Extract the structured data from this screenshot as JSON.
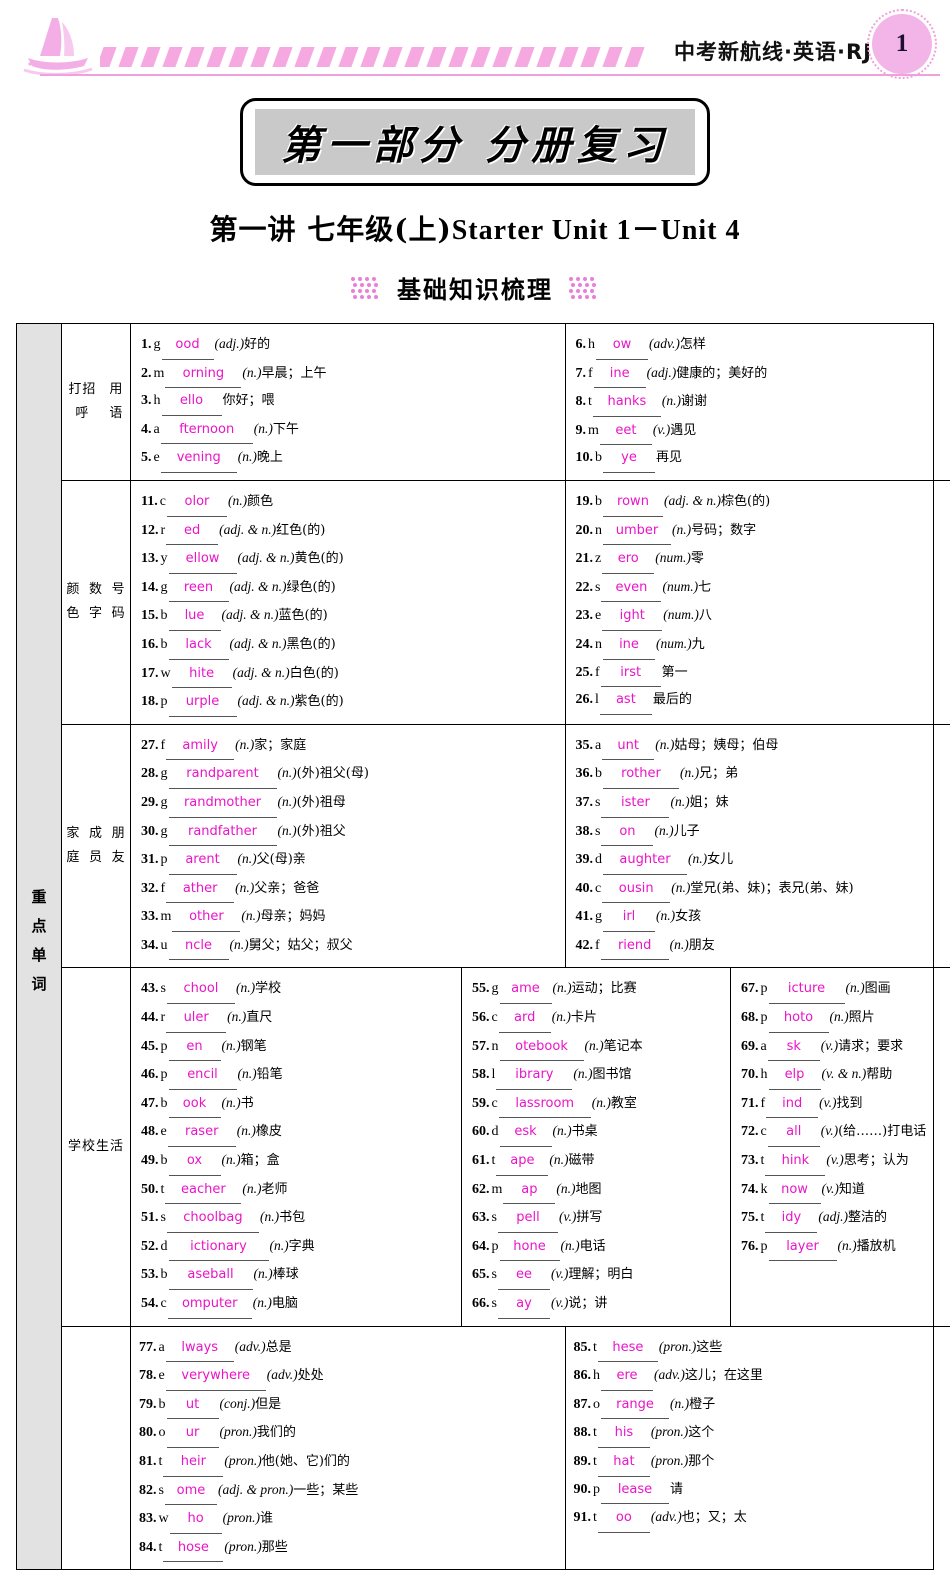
{
  "header": {
    "title": "中考新航线·英语·RJ",
    "page_number": "1",
    "logo": "sailboat-logo"
  },
  "part": {
    "title": "第一部分  分册复习"
  },
  "lecture": {
    "cn": "第一讲   七年级(上)",
    "en": "Starter Unit 1－Unit 4"
  },
  "section": {
    "heading": "基础知识梳理"
  },
  "sidebar": {
    "label": "重点单词"
  },
  "colors": {
    "answer": "#ea14c8",
    "accent": "#f0a0da",
    "sidebar_bg": "#e2e2e2"
  },
  "bands": [
    {
      "category": "打招呼\n用语",
      "columns": [
        {
          "entries": [
            {
              "num": "1.",
              "pre": "g",
              "ans": "ood",
              "pos": "(adj.)",
              "cn": "好的"
            },
            {
              "num": "2.",
              "pre": "m",
              "ans": "orning",
              "pos": "(n.)",
              "cn": "早晨；上午"
            },
            {
              "num": "3.",
              "pre": "h",
              "ans": "ello",
              "pos": "",
              "cn": "你好；喂"
            },
            {
              "num": "4.",
              "pre": "a",
              "ans": "fternoon",
              "pos": "(n.)",
              "cn": "下午"
            },
            {
              "num": "5.",
              "pre": "e",
              "ans": "vening",
              "pos": "(n.)",
              "cn": "晚上"
            }
          ]
        },
        {
          "entries": [
            {
              "num": "6.",
              "pre": "h",
              "ans": "ow",
              "pos": "(adv.)",
              "cn": "怎样"
            },
            {
              "num": "7.",
              "pre": "f",
              "ans": "ine",
              "pos": "(adj.)",
              "cn": "健康的；美好的"
            },
            {
              "num": "8.",
              "pre": "t",
              "ans": "hanks",
              "pos": "(n.)",
              "cn": "谢谢"
            },
            {
              "num": "9.",
              "pre": "m",
              "ans": "eet",
              "pos": "(v.)",
              "cn": "遇见"
            },
            {
              "num": "10.",
              "pre": "b",
              "ans": "ye",
              "pos": "",
              "cn": "再见"
            }
          ]
        }
      ]
    },
    {
      "category": "颜色\n数字\n号码",
      "columns": [
        {
          "entries": [
            {
              "num": "11.",
              "pre": "c",
              "ans": "olor",
              "pos": "(n.)",
              "cn": "颜色"
            },
            {
              "num": "12.",
              "pre": "r",
              "ans": "ed",
              "pos": "(adj. & n.)",
              "cn": "红色(的)"
            },
            {
              "num": "13.",
              "pre": "y",
              "ans": "ellow",
              "pos": "(adj. & n.)",
              "cn": "黄色(的)"
            },
            {
              "num": "14.",
              "pre": "g",
              "ans": "reen",
              "pos": "(adj. & n.)",
              "cn": "绿色(的)"
            },
            {
              "num": "15.",
              "pre": "b",
              "ans": "lue",
              "pos": "(adj. & n.)",
              "cn": "蓝色(的)"
            },
            {
              "num": "16.",
              "pre": "b",
              "ans": "lack",
              "pos": "(adj. & n.)",
              "cn": "黑色(的)"
            },
            {
              "num": "17.",
              "pre": "w",
              "ans": "hite",
              "pos": "(adj. & n.)",
              "cn": "白色(的)"
            },
            {
              "num": "18.",
              "pre": "p",
              "ans": "urple",
              "pos": "(adj. & n.)",
              "cn": "紫色(的)"
            }
          ]
        },
        {
          "entries": [
            {
              "num": "19.",
              "pre": "b",
              "ans": "rown",
              "pos": "(adj. & n.)",
              "cn": "棕色(的)"
            },
            {
              "num": "20.",
              "pre": "n",
              "ans": "umber",
              "pos": "(n.)",
              "cn": "号码；数字"
            },
            {
              "num": "21.",
              "pre": "z",
              "ans": "ero",
              "pos": "(num.)",
              "cn": "零"
            },
            {
              "num": "22.",
              "pre": "s",
              "ans": "even",
              "pos": "(num.)",
              "cn": "七"
            },
            {
              "num": "23.",
              "pre": "e",
              "ans": "ight",
              "pos": "(num.)",
              "cn": "八"
            },
            {
              "num": "24.",
              "pre": "n",
              "ans": "ine",
              "pos": "(num.)",
              "cn": "九"
            },
            {
              "num": "25.",
              "pre": "f",
              "ans": "irst",
              "pos": "",
              "cn": "第一"
            },
            {
              "num": "26.",
              "pre": "l",
              "ans": "ast",
              "pos": "",
              "cn": "最后的"
            }
          ]
        }
      ]
    },
    {
      "category": "家庭\n成员\n朋友",
      "columns": [
        {
          "entries": [
            {
              "num": "27.",
              "pre": "f",
              "ans": "amily",
              "pos": "(n.)",
              "cn": "家；家庭"
            },
            {
              "num": "28.",
              "pre": "g",
              "ans": "randparent",
              "pos": "(n.)",
              "cn": "(外)祖父(母)"
            },
            {
              "num": "29.",
              "pre": "g",
              "ans": "randmother",
              "pos": "(n.)",
              "cn": "(外)祖母"
            },
            {
              "num": "30.",
              "pre": "g",
              "ans": "randfather",
              "pos": "(n.)",
              "cn": "(外)祖父"
            },
            {
              "num": "31.",
              "pre": "p",
              "ans": "arent",
              "pos": "(n.)",
              "cn": "父(母)亲"
            },
            {
              "num": "32.",
              "pre": "f",
              "ans": "ather",
              "pos": "(n.)",
              "cn": "父亲；爸爸"
            },
            {
              "num": "33.",
              "pre": "m",
              "ans": "other",
              "pos": "(n.)",
              "cn": "母亲；妈妈"
            },
            {
              "num": "34.",
              "pre": "u",
              "ans": "ncle",
              "pos": "(n.)",
              "cn": "舅父；姑父；叔父"
            }
          ]
        },
        {
          "entries": [
            {
              "num": "35.",
              "pre": "a",
              "ans": "unt",
              "pos": "(n.)",
              "cn": "姑母；姨母；伯母"
            },
            {
              "num": "36.",
              "pre": "b",
              "ans": "rother",
              "pos": "(n.)",
              "cn": "兄；弟"
            },
            {
              "num": "37.",
              "pre": "s",
              "ans": "ister",
              "pos": "(n.)",
              "cn": "姐；妹"
            },
            {
              "num": "38.",
              "pre": "s",
              "ans": "on",
              "pos": "(n.)",
              "cn": "儿子"
            },
            {
              "num": "39.",
              "pre": "d",
              "ans": "aughter",
              "pos": "(n.)",
              "cn": "女儿"
            },
            {
              "num": "40.",
              "pre": "c",
              "ans": "ousin",
              "pos": "(n.)",
              "cn": "堂兄(弟、妹)；表兄(弟、妹)"
            },
            {
              "num": "41.",
              "pre": "g",
              "ans": "irl",
              "pos": "(n.)",
              "cn": "女孩"
            },
            {
              "num": "42.",
              "pre": "f",
              "ans": "riend",
              "pos": "(n.)",
              "cn": "朋友"
            }
          ]
        }
      ]
    },
    {
      "category": "学\n校\n生\n活",
      "columns": [
        {
          "entries": [
            {
              "num": "43.",
              "pre": "s",
              "ans": "chool",
              "pos": "(n.)",
              "cn": "学校"
            },
            {
              "num": "44.",
              "pre": "r",
              "ans": "uler",
              "pos": "(n.)",
              "cn": "直尺"
            },
            {
              "num": "45.",
              "pre": "p",
              "ans": "en",
              "pos": "(n.)",
              "cn": "钢笔"
            },
            {
              "num": "46.",
              "pre": "p",
              "ans": "encil",
              "pos": "(n.)",
              "cn": "铅笔"
            },
            {
              "num": "47.",
              "pre": "b",
              "ans": "ook",
              "pos": "(n.)",
              "cn": "书"
            },
            {
              "num": "48.",
              "pre": "e",
              "ans": "raser",
              "pos": "(n.)",
              "cn": "橡皮"
            },
            {
              "num": "49.",
              "pre": "b",
              "ans": "ox",
              "pos": "(n.)",
              "cn": "箱；盒"
            },
            {
              "num": "50.",
              "pre": "t",
              "ans": "eacher",
              "pos": "(n.)",
              "cn": "老师"
            },
            {
              "num": "51.",
              "pre": "s",
              "ans": "choolbag",
              "pos": "(n.)",
              "cn": "书包"
            },
            {
              "num": "52.",
              "pre": "d",
              "ans": "ictionary",
              "pos": "(n.)",
              "cn": "字典"
            },
            {
              "num": "53.",
              "pre": "b",
              "ans": "aseball",
              "pos": "(n.)",
              "cn": "棒球"
            },
            {
              "num": "54.",
              "pre": "c",
              "ans": "omputer",
              "pos": "(n.)",
              "cn": "电脑"
            }
          ]
        },
        {
          "entries": [
            {
              "num": "55.",
              "pre": "g",
              "ans": "ame",
              "pos": "(n.)",
              "cn": "运动；比赛"
            },
            {
              "num": "56.",
              "pre": "c",
              "ans": "ard",
              "pos": "(n.)",
              "cn": "卡片"
            },
            {
              "num": "57.",
              "pre": "n",
              "ans": "otebook",
              "pos": "(n.)",
              "cn": "笔记本"
            },
            {
              "num": "58.",
              "pre": "l",
              "ans": "ibrary",
              "pos": "(n.)",
              "cn": "图书馆"
            },
            {
              "num": "59.",
              "pre": "c",
              "ans": "lassroom",
              "pos": "(n.)",
              "cn": "教室"
            },
            {
              "num": "60.",
              "pre": "d",
              "ans": "esk",
              "pos": "(n.)",
              "cn": "书桌"
            },
            {
              "num": "61.",
              "pre": "t",
              "ans": "ape",
              "pos": "(n.)",
              "cn": "磁带"
            },
            {
              "num": "62.",
              "pre": "m",
              "ans": "ap",
              "pos": "(n.)",
              "cn": "地图"
            },
            {
              "num": "63.",
              "pre": "s",
              "ans": "pell",
              "pos": "(v.)",
              "cn": "拼写"
            },
            {
              "num": "64.",
              "pre": "p",
              "ans": "hone",
              "pos": "(n.)",
              "cn": "电话"
            },
            {
              "num": "65.",
              "pre": "s",
              "ans": "ee",
              "pos": "(v.)",
              "cn": "理解；明白"
            },
            {
              "num": "66.",
              "pre": "s",
              "ans": "ay",
              "pos": "(v.)",
              "cn": "说；讲"
            }
          ]
        },
        {
          "entries": [
            {
              "num": "67.",
              "pre": "p",
              "ans": "icture",
              "pos": "(n.)",
              "cn": "图画"
            },
            {
              "num": "68.",
              "pre": "p",
              "ans": "hoto",
              "pos": "(n.)",
              "cn": "照片"
            },
            {
              "num": "69.",
              "pre": "a",
              "ans": "sk",
              "pos": "(v.)",
              "cn": "请求；要求"
            },
            {
              "num": "70.",
              "pre": "h",
              "ans": "elp",
              "pos": "(v. & n.)",
              "cn": "帮助"
            },
            {
              "num": "71.",
              "pre": "f",
              "ans": "ind",
              "pos": "(v.)",
              "cn": "找到"
            },
            {
              "num": "72.",
              "pre": "c",
              "ans": "all",
              "pos": "(v.)",
              "cn": "(给……)打电话"
            },
            {
              "num": "73.",
              "pre": "t",
              "ans": "hink",
              "pos": "(v.)",
              "cn": "思考；认为"
            },
            {
              "num": "74.",
              "pre": "k",
              "ans": "now",
              "pos": "(v.)",
              "cn": "知道"
            },
            {
              "num": "75.",
              "pre": "t",
              "ans": "idy",
              "pos": "(adj.)",
              "cn": "整洁的"
            },
            {
              "num": "76.",
              "pre": "p",
              "ans": "layer",
              "pos": "(n.)",
              "cn": "播放机"
            }
          ]
        }
      ]
    },
    {
      "category": "",
      "columns": [
        {
          "entries": [
            {
              "num": "77.",
              "pre": "a",
              "ans": "lways",
              "pos": "(adv.)",
              "cn": "总是"
            },
            {
              "num": "78.",
              "pre": "e",
              "ans": "verywhere",
              "pos": "(adv.)",
              "cn": "处处"
            },
            {
              "num": "79.",
              "pre": "b",
              "ans": "ut",
              "pos": "(conj.)",
              "cn": "但是"
            },
            {
              "num": "80.",
              "pre": "o",
              "ans": "ur",
              "pos": "(pron.)",
              "cn": "我们的"
            },
            {
              "num": "81.",
              "pre": "t",
              "ans": "heir",
              "pos": "(pron.)",
              "cn": "他(她、它)们的"
            },
            {
              "num": "82.",
              "pre": "s",
              "ans": "ome",
              "pos": "(adj. & pron.)",
              "cn": "一些；某些"
            },
            {
              "num": "83.",
              "pre": "w",
              "ans": "ho",
              "pos": "(pron.)",
              "cn": "谁"
            },
            {
              "num": "84.",
              "pre": "t",
              "ans": "hose",
              "pos": "(pron.)",
              "cn": "那些"
            }
          ]
        },
        {
          "entries": [
            {
              "num": "85.",
              "pre": "t",
              "ans": "hese",
              "pos": "(pron.)",
              "cn": "这些"
            },
            {
              "num": "86.",
              "pre": "h",
              "ans": "ere",
              "pos": "(adv.)",
              "cn": "这儿；在这里"
            },
            {
              "num": "87.",
              "pre": "o",
              "ans": "range",
              "pos": "(n.)",
              "cn": "橙子"
            },
            {
              "num": "88.",
              "pre": "t",
              "ans": "his",
              "pos": "(pron.)",
              "cn": "这个"
            },
            {
              "num": "89.",
              "pre": "t",
              "ans": "hat",
              "pos": "(pron.)",
              "cn": "那个"
            },
            {
              "num": "90.",
              "pre": "p",
              "ans": "lease",
              "pos": "",
              "cn": "请"
            },
            {
              "num": "91.",
              "pre": "t",
              "ans": "oo",
              "pos": "(adv.)",
              "cn": "也；又；太"
            }
          ]
        }
      ]
    }
  ]
}
